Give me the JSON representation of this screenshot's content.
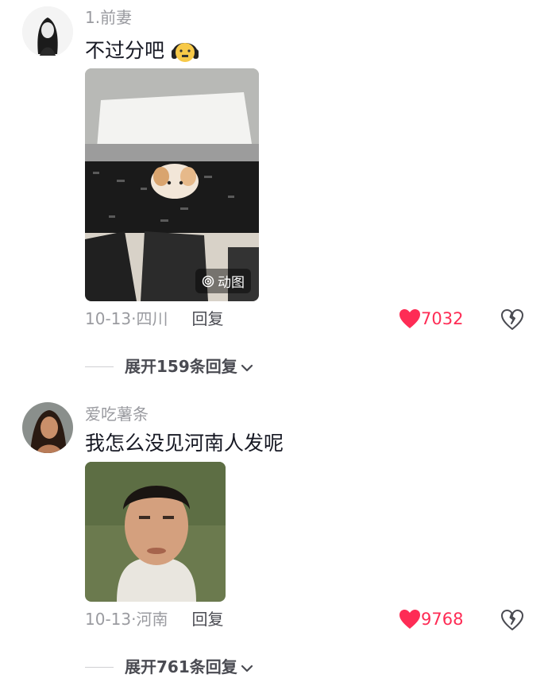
{
  "comments": [
    {
      "username": "1.前妻",
      "text": "不过分吧",
      "emoji": "headphones-face",
      "media_badge": "动图",
      "time": "10-13·四川",
      "reply": "回复",
      "likes": "7032",
      "expand": "展开159条回复"
    },
    {
      "username": "爱吃薯条",
      "text": "我怎么没见河南人发呢",
      "time": "10-13·河南",
      "reply": "回复",
      "likes": "9768",
      "expand": "展开761条回复"
    }
  ],
  "colors": {
    "like": "#fe2c55",
    "secondary_text": "#9a9ba0"
  }
}
